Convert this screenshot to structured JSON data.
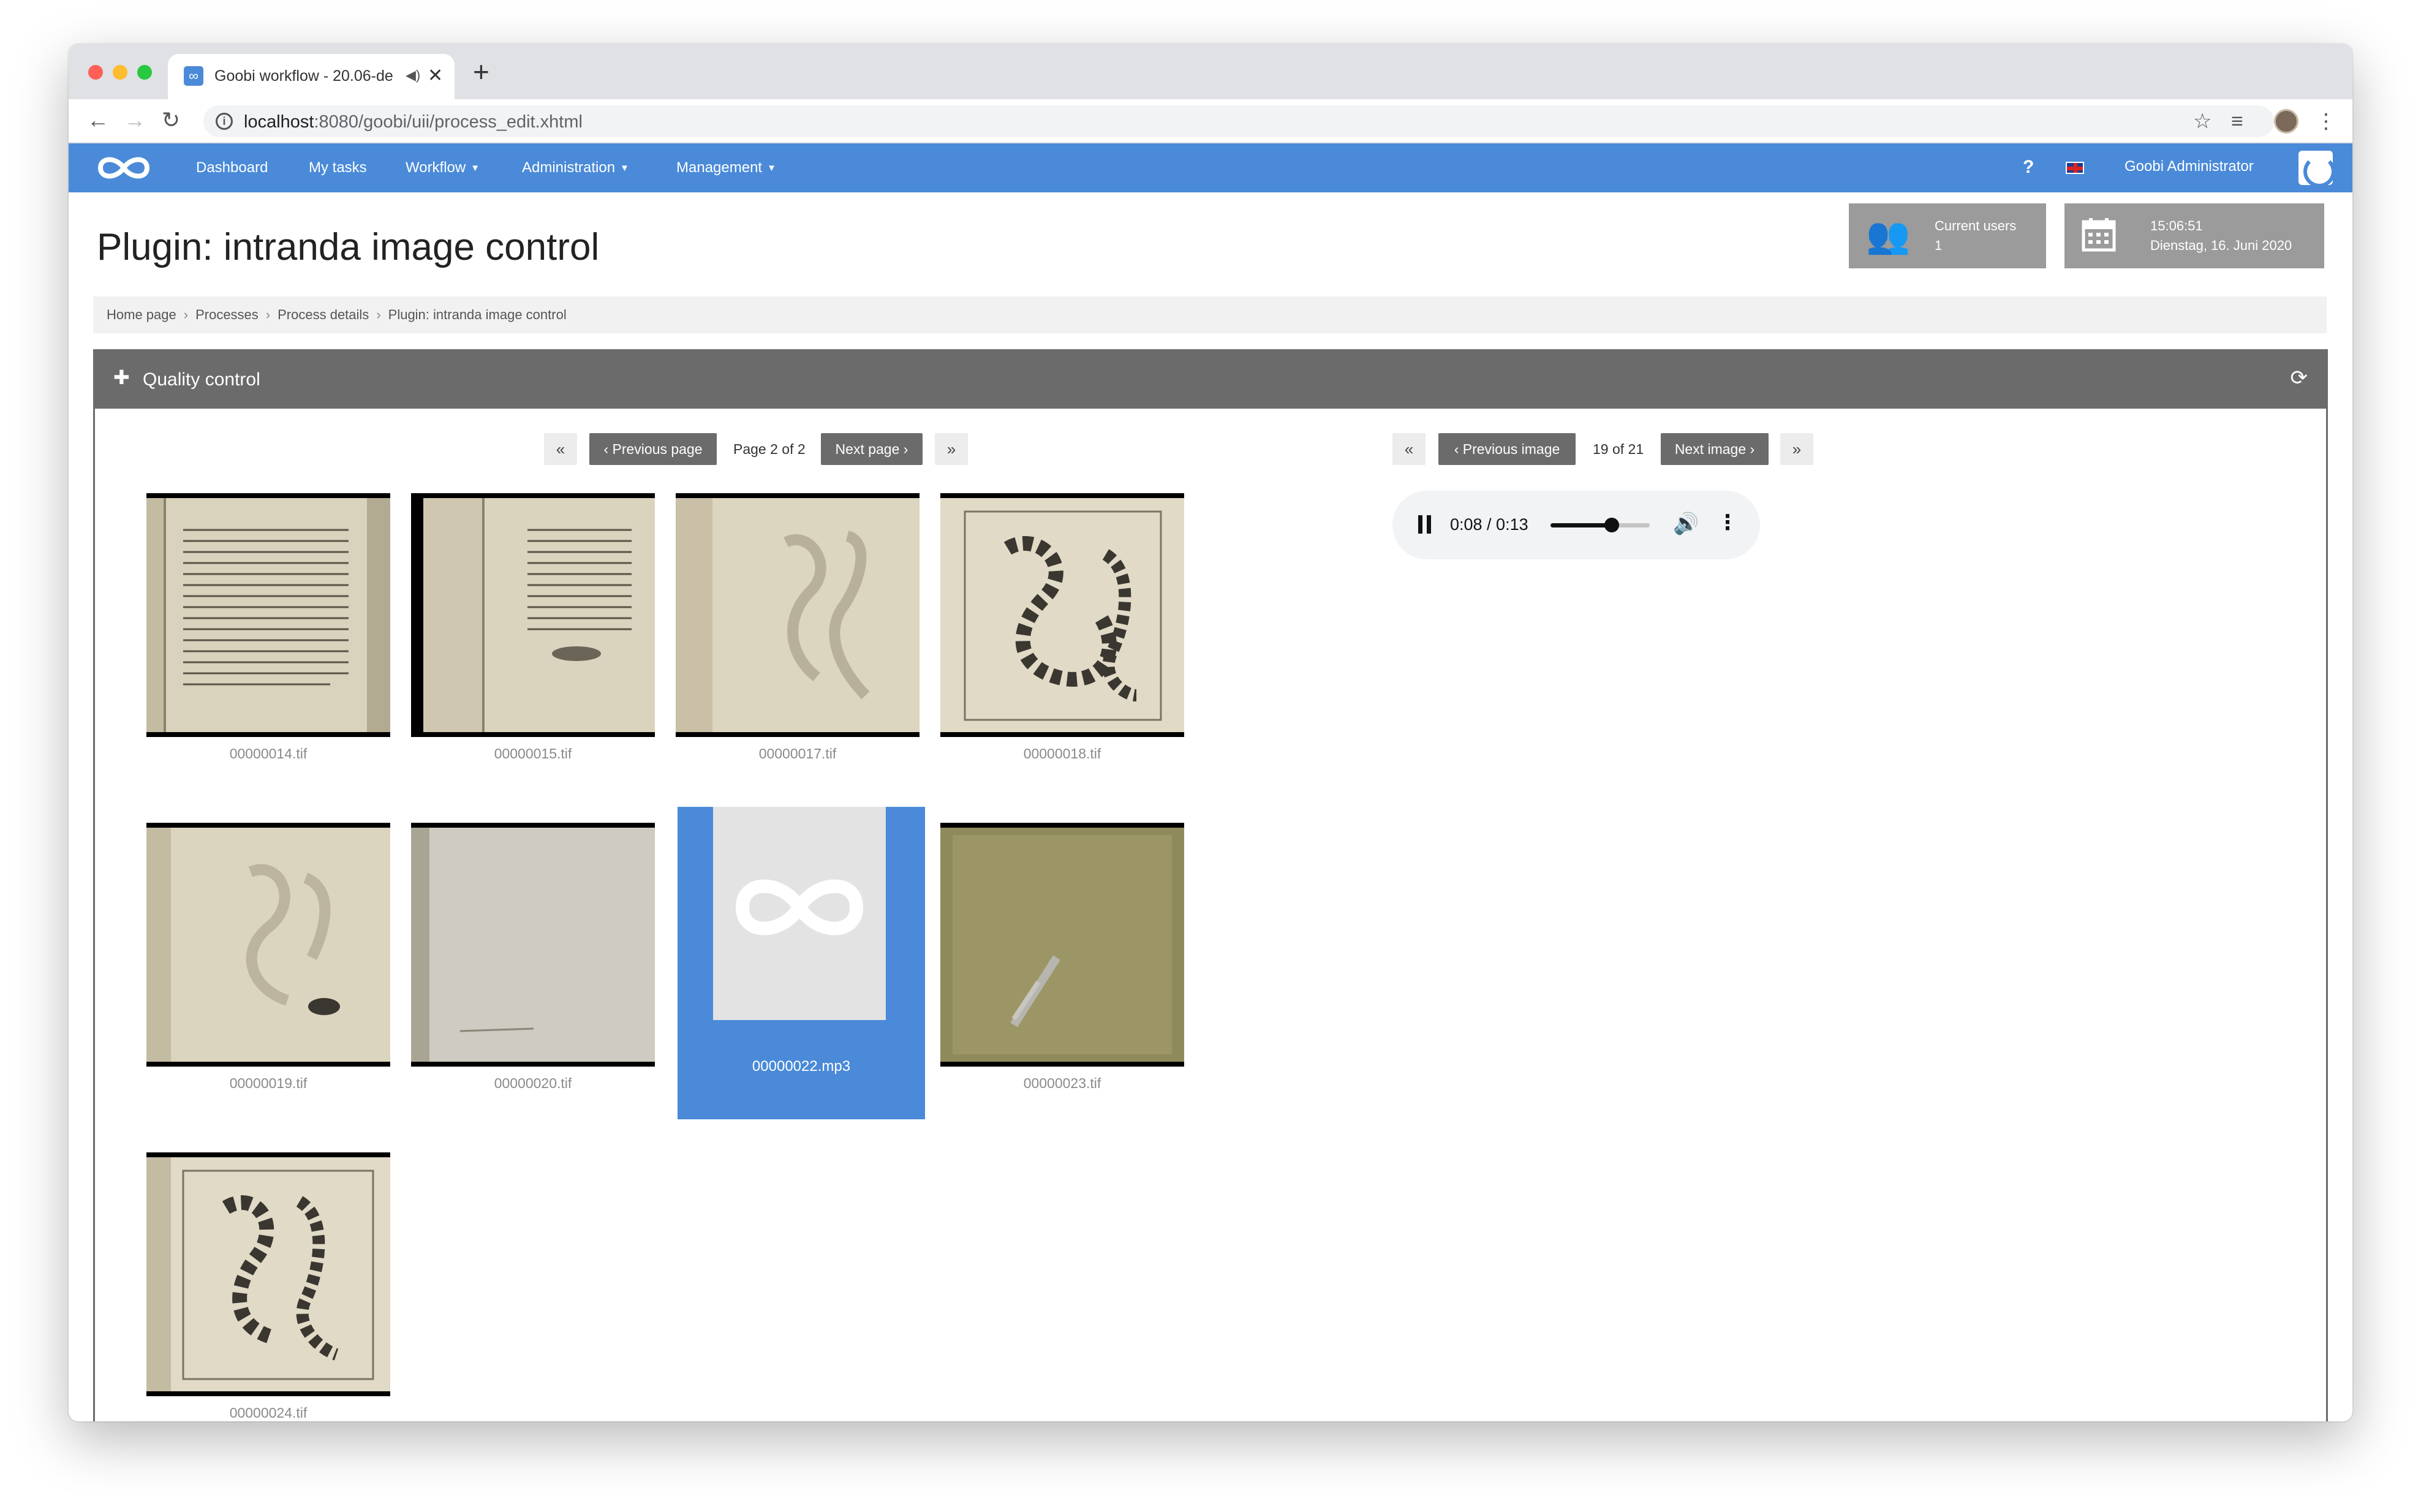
{
  "browser": {
    "tab_title": "Goobi workflow - 20.06-de",
    "url_host": "localhost",
    "url_rest": ":8080/goobi/uii/process_edit.xhtml"
  },
  "navbar": {
    "items": [
      "Dashboard",
      "My tasks",
      "Workflow",
      "Administration",
      "Management"
    ],
    "help": "?",
    "user": "Goobi Administrator"
  },
  "header": {
    "title": "Plugin: intranda image control",
    "current_users_label": "Current users",
    "current_users_count": "1",
    "time": "15:06:51",
    "date": "Dienstag, 16. Juni 2020"
  },
  "breadcrumb": [
    "Home page",
    "Processes",
    "Process details",
    "Plugin: intranda image control"
  ],
  "panel": {
    "title": "Quality control",
    "page_pager": {
      "first": "«",
      "prev": "‹ Previous page",
      "label": "Page 2 of 2",
      "next": "Next page ›",
      "last": "»"
    },
    "image_pager": {
      "first": "«",
      "prev": "‹ Previous image",
      "label": "19 of 21",
      "next": "Next image ›",
      "last": "»"
    },
    "thumbnails": [
      {
        "file": "00000014.tif",
        "kind": "text"
      },
      {
        "file": "00000015.tif",
        "kind": "text2"
      },
      {
        "file": "00000017.tif",
        "kind": "snake-faint"
      },
      {
        "file": "00000018.tif",
        "kind": "snake-dark"
      },
      {
        "file": "00000019.tif",
        "kind": "snake-faint2"
      },
      {
        "file": "00000020.tif",
        "kind": "blank"
      },
      {
        "file": "00000022.mp3",
        "kind": "audio-selected"
      },
      {
        "file": "00000023.tif",
        "kind": "cover"
      },
      {
        "file": "00000024.tif",
        "kind": "snake-dark2"
      }
    ],
    "audio": {
      "time": "0:08 / 0:13",
      "progress": 0.615
    }
  },
  "colors": {
    "brand": "#4a8ad8",
    "panel_header": "#6b6b6b",
    "info_box": "#9b9b9b"
  }
}
